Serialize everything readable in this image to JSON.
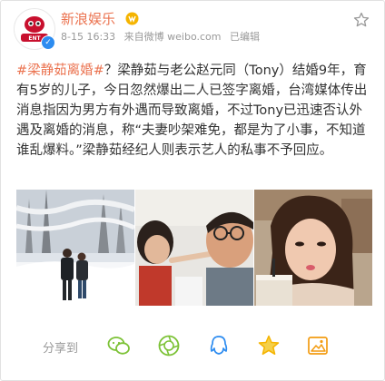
{
  "header": {
    "username": "新浪娱乐",
    "date": "8-15 16:33",
    "source": "来自微博 weibo.com",
    "edited": "已编辑",
    "verified_mark": "✓"
  },
  "post": {
    "topic": "#梁静茹离婚#",
    "text": "？梁静茹与老公赵元同（Tony）结婚9年，育有5岁的儿子，今日忽然爆出二人已签字离婚，台湾媒体传出消息指因为男方有外遇而导致离婚，不过Tony已迅速否认外遇及离婚的消息，称“夫妻吵架难免，都是为了小事，不知道谁乱爆料。”梁静茹经纪人则表示艺人的私事不予回应。"
  },
  "share": {
    "label": "分享到"
  },
  "colors": {
    "accent": "#eb7350",
    "meta": "#999999",
    "text": "#333333",
    "icon_green": "#7cc236",
    "icon_blue": "#2d8cf0",
    "icon_yellow": "#f5b400",
    "icon_orange": "#f39c12"
  },
  "icons": [
    "star-icon",
    "wechat-icon",
    "moments-icon",
    "qq-icon",
    "qzone-icon",
    "image-save-icon"
  ]
}
